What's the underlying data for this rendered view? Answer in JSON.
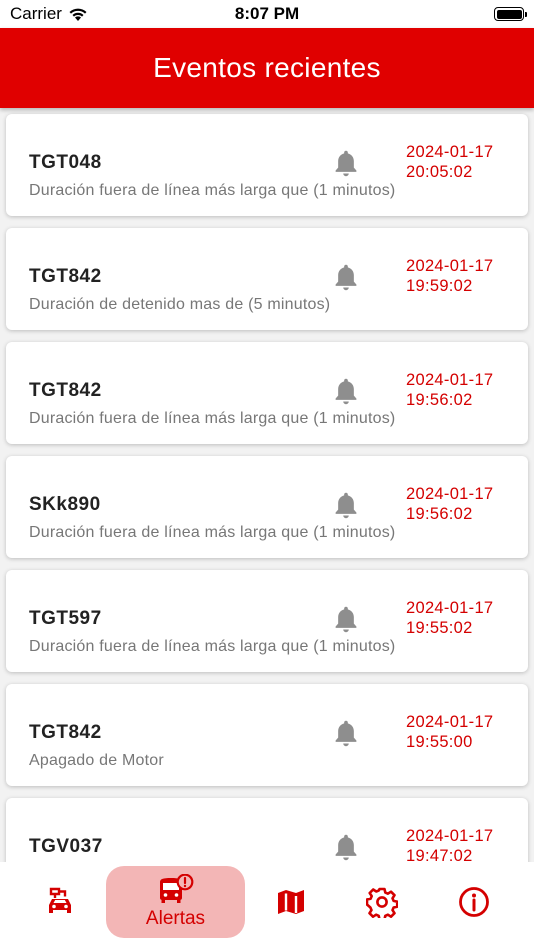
{
  "status_bar": {
    "carrier": "Carrier",
    "time": "8:07 PM"
  },
  "header": {
    "title": "Eventos recientes"
  },
  "events": [
    {
      "plate": "TGT048",
      "description": "Duración fuera de línea más larga que (1 minutos)",
      "date": "2024-01-17",
      "time": "20:05:02",
      "icon": "bell-icon"
    },
    {
      "plate": "TGT842",
      "description": "Duración de detenido mas de (5 minutos)",
      "date": "2024-01-17",
      "time": "19:59:02",
      "icon": "bell-icon"
    },
    {
      "plate": "TGT842",
      "description": "Duración fuera de línea más larga que (1 minutos)",
      "date": "2024-01-17",
      "time": "19:56:02",
      "icon": "bell-icon"
    },
    {
      "plate": "SKk890",
      "description": "Duración fuera de línea más larga que (1 minutos)",
      "date": "2024-01-17",
      "time": "19:56:02",
      "icon": "bell-icon"
    },
    {
      "plate": "TGT597",
      "description": "Duración fuera de línea más larga que (1 minutos)",
      "date": "2024-01-17",
      "time": "19:55:02",
      "icon": "bell-icon"
    },
    {
      "plate": "TGT842",
      "description": "Apagado de Motor",
      "date": "2024-01-17",
      "time": "19:55:00",
      "icon": "bell-icon"
    },
    {
      "plate": "TGV037",
      "description": "",
      "date": "2024-01-17",
      "time": "19:47:02",
      "icon": "bell-icon"
    }
  ],
  "tabs": [
    {
      "id": "vehicles",
      "icon": "car-charger-icon",
      "label": ""
    },
    {
      "id": "alerts",
      "icon": "bus-alert-icon",
      "label": "Alertas",
      "active": true
    },
    {
      "id": "map",
      "icon": "map-icon",
      "label": ""
    },
    {
      "id": "settings",
      "icon": "gear-icon",
      "label": ""
    },
    {
      "id": "info",
      "icon": "info-icon",
      "label": ""
    }
  ],
  "colors": {
    "brand_red": "#e00000",
    "date_red": "#d40000",
    "active_tab_bg": "#f3b6b6",
    "bell_gray": "#8e8e8e"
  }
}
